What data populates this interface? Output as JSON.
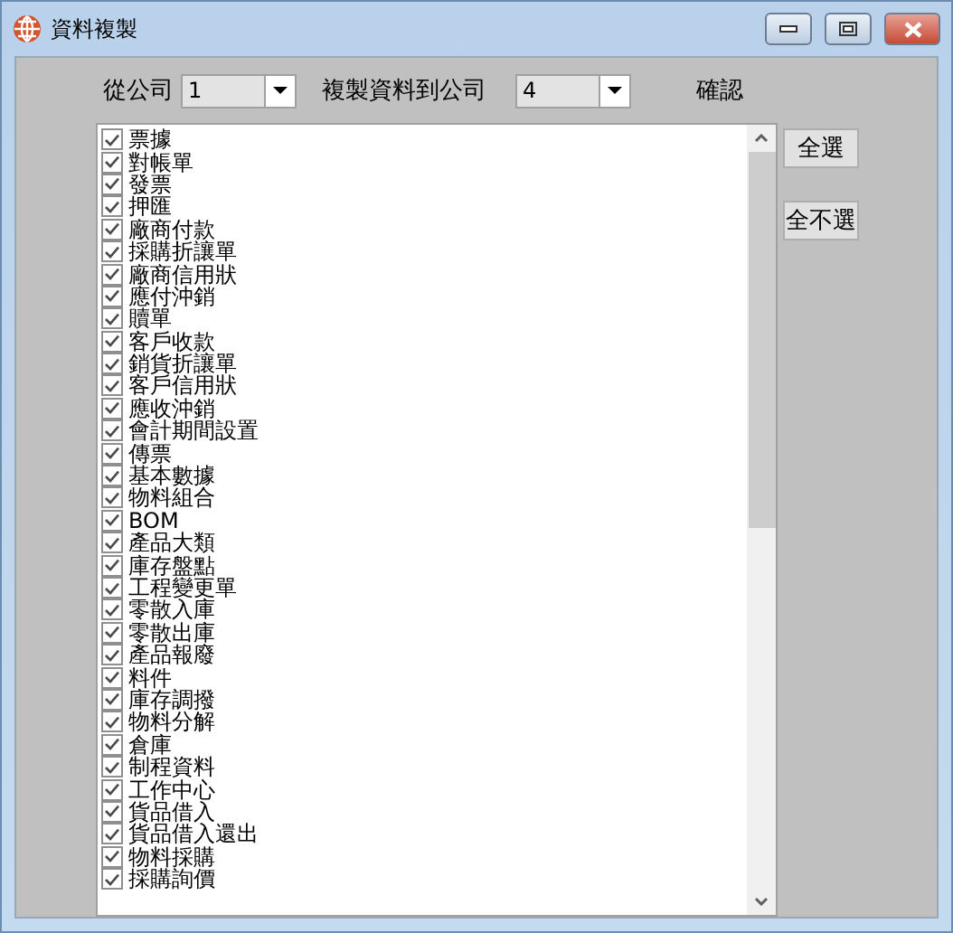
{
  "window": {
    "title": "資料複製"
  },
  "from_company": {
    "label": "從公司",
    "value": "1"
  },
  "to_company": {
    "label": "複製資料到公司",
    "value": "4"
  },
  "confirm_label": "確認",
  "items": [
    {
      "label": "票據",
      "checked": true
    },
    {
      "label": "對帳單",
      "checked": true
    },
    {
      "label": "發票",
      "checked": true
    },
    {
      "label": "押匯",
      "checked": true
    },
    {
      "label": "廠商付款",
      "checked": true
    },
    {
      "label": "採購折讓單",
      "checked": true
    },
    {
      "label": "廠商信用狀",
      "checked": true
    },
    {
      "label": "應付沖銷",
      "checked": true
    },
    {
      "label": "贖單",
      "checked": true
    },
    {
      "label": "客戶收款",
      "checked": true
    },
    {
      "label": "銷貨折讓單",
      "checked": true
    },
    {
      "label": "客戶信用狀",
      "checked": true
    },
    {
      "label": "應收沖銷",
      "checked": true
    },
    {
      "label": "會計期間設置",
      "checked": true
    },
    {
      "label": "傳票",
      "checked": true
    },
    {
      "label": "基本數據",
      "checked": true
    },
    {
      "label": "物料組合",
      "checked": true
    },
    {
      "label": "BOM",
      "checked": true
    },
    {
      "label": "產品大類",
      "checked": true
    },
    {
      "label": "庫存盤點",
      "checked": true
    },
    {
      "label": "工程變更單",
      "checked": true
    },
    {
      "label": "零散入庫",
      "checked": true
    },
    {
      "label": "零散出庫",
      "checked": true
    },
    {
      "label": "產品報廢",
      "checked": true
    },
    {
      "label": "料件",
      "checked": true
    },
    {
      "label": "庫存調撥",
      "checked": true
    },
    {
      "label": "物料分解",
      "checked": true
    },
    {
      "label": "倉庫",
      "checked": true
    },
    {
      "label": "制程資料",
      "checked": true
    },
    {
      "label": "工作中心",
      "checked": true
    },
    {
      "label": "貨品借入",
      "checked": true
    },
    {
      "label": "貨品借入還出",
      "checked": true
    },
    {
      "label": "物料採購",
      "checked": true
    },
    {
      "label": "採購詢價",
      "checked": true
    }
  ],
  "buttons": [
    "全選",
    "全不選"
  ]
}
